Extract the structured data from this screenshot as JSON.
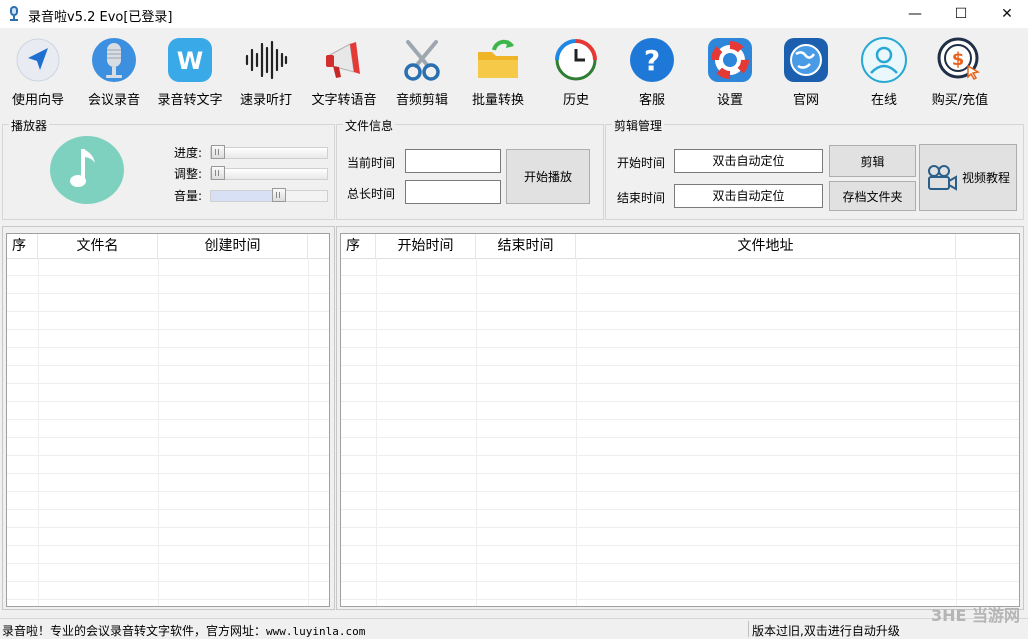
{
  "window": {
    "title": "录音啦v5.2 Evo[已登录]",
    "controls": {
      "minimize": "—",
      "maximize": "☐",
      "close": "✕"
    }
  },
  "toolbar": {
    "items": [
      {
        "label": "使用向导",
        "icon": "navigation-arrow-icon"
      },
      {
        "label": "会议录音",
        "icon": "microphone-icon"
      },
      {
        "label": "录音转文字",
        "icon": "w-logo-icon"
      },
      {
        "label": "速录听打",
        "icon": "waveform-icon"
      },
      {
        "label": "文字转语音",
        "icon": "megaphone-icon"
      },
      {
        "label": "音频剪辑",
        "icon": "scissors-icon"
      },
      {
        "label": "批量转换",
        "icon": "folder-refresh-icon"
      },
      {
        "label": "历史",
        "icon": "clock-history-icon"
      },
      {
        "label": "客服",
        "icon": "help-icon"
      },
      {
        "label": "设置",
        "icon": "lifebuoy-icon"
      },
      {
        "label": "官网",
        "icon": "globe-icon"
      },
      {
        "label": "在线",
        "icon": "user-icon"
      },
      {
        "label": "购买/充值",
        "icon": "dollar-coin-icon"
      }
    ]
  },
  "player": {
    "title": "播放器",
    "progress_label": "进度:",
    "adjust_label": "调整:",
    "volume_label": "音量:",
    "progress_value": 0,
    "adjust_value": 0,
    "volume_value": 0.6
  },
  "fileinfo": {
    "title": "文件信息",
    "current_time_label": "当前时间",
    "total_time_label": "总长时间",
    "current_time_value": "",
    "total_time_value": "",
    "play_button": "开始播放"
  },
  "editing": {
    "title": "剪辑管理",
    "start_label": "开始时间",
    "end_label": "结束时间",
    "start_value": "双击自动定位",
    "end_value": "双击自动定位",
    "cut_button": "剪辑",
    "archive_button": "存档文件夹",
    "tutorial_button": "视频教程"
  },
  "file_table": {
    "columns": [
      "序",
      "文件名",
      "创建时间"
    ]
  },
  "clip_table": {
    "columns": [
      "序",
      "开始时间",
      "结束时间",
      "文件地址"
    ]
  },
  "status": {
    "left_text": "录音啦！专业的会议录音转文字软件，官方网址：",
    "url": "www.luyinla.com",
    "right_text": "版本过旧,双击进行自动升级"
  },
  "watermark": "3HE 当游网",
  "colors": {
    "accent": "#1e88e5",
    "music_bg": "#7fd1bf"
  }
}
